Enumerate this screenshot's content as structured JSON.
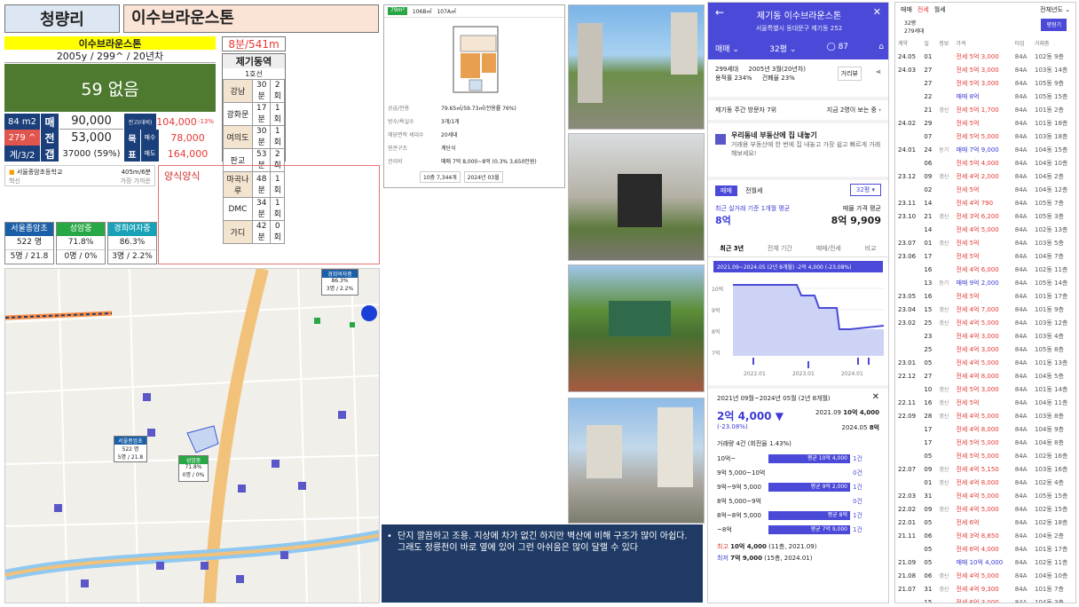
{
  "header": {
    "area": "청량리",
    "name": "이수브라운스톤"
  },
  "summary": {
    "name": "이수브라운스톤",
    "meta": "2005y / 299^ / 20년차",
    "walk": "8분/541m",
    "station": "제기동역",
    "line": "1호선",
    "big": "59 없음",
    "size": "84 m2",
    "size2": "279 ^",
    "plan": "계/3/2",
    "r1": {
      "k": "매",
      "v": "90,000",
      "k2": "전고(대비)",
      "v2": "104,000",
      "pct": "-13%"
    },
    "r2": {
      "k": "전",
      "v": "53,000",
      "k2": "목",
      "k3": "매수",
      "v2": "78,000"
    },
    "r3": {
      "k": "갭",
      "v": "37000 (59%)",
      "k2": "표",
      "k3": "매도",
      "v2": "164,000"
    }
  },
  "commute": [
    [
      "강남",
      "30분",
      "2회"
    ],
    [
      "광화문",
      "17분",
      "1회"
    ],
    [
      "여의도",
      "30분",
      "1회"
    ],
    [
      "판교",
      "53분",
      "2회"
    ],
    [
      "마곡나루",
      "48분",
      "1회"
    ],
    [
      "DMC",
      "34분",
      "1회"
    ],
    [
      "가디",
      "42분",
      "0회"
    ]
  ],
  "school": {
    "name": "서울종암초등학교",
    "dist": "405m/6분",
    "sub": "혁신",
    "sub2": "가장 가까운"
  },
  "note_box": "양식양식",
  "schools": [
    {
      "name": "서울종암초",
      "color": "#1a5fa8",
      "a": "522 명",
      "b": "5명 / 21.8"
    },
    {
      "name": "성암중",
      "color": "#28a745",
      "a": "71.8%",
      "b": "0명 / 0%"
    },
    {
      "name": "경희여자중",
      "color": "#17a2b8",
      "a": "86.3%",
      "b": "3명 / 2.2%"
    }
  ],
  "map": {
    "lbl1": {
      "t": "경희여자중",
      "a": "86.3%",
      "b": "3명 / 2.2%"
    },
    "lbl2": {
      "t": "서울종암초",
      "a": "522 명",
      "b": "5명 / 21.8"
    },
    "lbl3": {
      "t": "성암중",
      "a": "71.8%",
      "b": "0명 / 0%"
    }
  },
  "plan": {
    "tab": "79m²",
    "s1": "106B㎡",
    "s2": "107A㎡",
    "rows": [
      [
        "공급/전용",
        "79.65㎡/59.73㎡(전용률 76%)"
      ],
      [
        "방수/욕실수",
        "3개/1개"
      ],
      [
        "해당면적 세대수",
        "20세대"
      ],
      [
        "현관구조",
        "계단식"
      ],
      [
        "관리비",
        "매매 7억 8,000~8억 (0.3% 3,650만원)"
      ]
    ],
    "floor": "10층 7,344개",
    "month": "2024년 03월"
  },
  "comment": "단지 깔끔하고 조용. 지상에 차가 없긴 하지만 벽산에 비해 구조가 많이 아쉽다. 그래도 정릉천이 바로 옆에 있어 그런 아쉬움은 많이 달랠 수 있다",
  "app": {
    "title": "제기동 이수브라운스톤",
    "addr": "서울특별시 동대문구 제기동 252",
    "tab1": "매매",
    "tab2": "32평",
    "cnt": "87",
    "info1": "299세대",
    "info2": "2005년 3월(20년차)",
    "info3": "용적률 234%",
    "info4": "건폐율 23%",
    "btn": "거리뷰",
    "visit": "제기동 주간 방문자 7위",
    "visit2": "지금 2명이 보는 중",
    "promo": "우리동네 부동산에 집 내놓기",
    "promo2": "거래용 부동산에 한 번에 집 내놓고 가장 쉽고 빠르게 거래해보세요!",
    "seg1": "매매",
    "seg2": "전월세",
    "py": "32평",
    "recent": "최근 실거래 기준 1개월 평균",
    "recentv": "8억",
    "avg": "매물 가격 평균",
    "avgv": "8억 9,909",
    "ctabs": [
      "최근 3년",
      "전체 기간",
      "매매/전세",
      "비교"
    ],
    "range": "2021.09~2024.05 (2년 8개월) -2억 4,000 (-23.08%)",
    "yt": [
      "10억",
      "9억",
      "8억",
      "7억"
    ],
    "xt": [
      "2022.01",
      "2023.01",
      "2024.01"
    ],
    "p_head": "2021년 09월~2024년 05월 (2년 8개월)",
    "p_big": "2억 4,000",
    "p_pct": "(-23.08%)",
    "p_r1": "2021.09",
    "p_r1v": "10억 4,000",
    "p_r2": "2024.05",
    "p_r2v": "8억",
    "p_cnt": "거래량 4건 (회전율 1.43%)",
    "bars": [
      [
        "10억~",
        "평균 10억 4,000",
        "1건"
      ],
      [
        "9억 5,000~10억",
        "",
        "0건"
      ],
      [
        "9억~9억 5,000",
        "평균 9억 2,000",
        "1건"
      ],
      [
        "8억 5,000~9억",
        "",
        "0건"
      ],
      [
        "8억~8억 5,000",
        "평균 8억",
        "1건"
      ],
      [
        "~8억",
        "평균 7억 9,000",
        "1건"
      ]
    ],
    "max": "10억 4,000",
    "maxs": "(11층, 2021.09)",
    "min": "7억 9,000",
    "mins": "(15층, 2024.01)",
    "maxl": "최고",
    "minl": "최저"
  },
  "tx": {
    "tabs": [
      "매매",
      "전세",
      "월세"
    ],
    "filter": "전체년도",
    "sel": "32평",
    "sel2": "279세대",
    "btn": "평형기",
    "hdr": [
      "계약",
      "일",
      "정보",
      "가격",
      "타입",
      "거래층"
    ],
    "rows": [
      [
        "24.05",
        "01",
        "",
        "전세 5억 3,000",
        "84A",
        "102동 9층"
      ],
      [
        "24.03",
        "27",
        "",
        "전세 5억 3,000",
        "84A",
        "103동 14층"
      ],
      [
        "",
        "27",
        "",
        "전세 5억 3,000",
        "84A",
        "105동 9층"
      ],
      [
        "",
        "22",
        "",
        "매매 8억",
        "84A",
        "105동 15층"
      ],
      [
        "",
        "21",
        "갱신",
        "전세 5억 1,700",
        "84A",
        "101동 2층"
      ],
      [
        "24.02",
        "29",
        "",
        "전세 5억",
        "84A",
        "101동 18층"
      ],
      [
        "",
        "07",
        "",
        "전세 5억 5,000",
        "84A",
        "103동 18층"
      ],
      [
        "24.01",
        "24",
        "등기",
        "매매 7억 9,000",
        "84A",
        "104동 15층"
      ],
      [
        "",
        "06",
        "",
        "전세 5억 4,000",
        "84A",
        "104동 10층"
      ],
      [
        "23.12",
        "09",
        "갱신",
        "전세 4억 2,000",
        "84A",
        "104동 2층"
      ],
      [
        "",
        "02",
        "",
        "전세 5억",
        "84A",
        "104동 12층"
      ],
      [
        "23.11",
        "14",
        "",
        "전세 4억 790",
        "84A",
        "105동 7층"
      ],
      [
        "23.10",
        "21",
        "갱신",
        "전세 3억 6,200",
        "84A",
        "105동 3층"
      ],
      [
        "",
        "14",
        "",
        "전세 4억 5,000",
        "84A",
        "102동 13층"
      ],
      [
        "23.07",
        "01",
        "갱신",
        "전세 5억",
        "84A",
        "103동 5층"
      ],
      [
        "23.06",
        "17",
        "",
        "전세 5억",
        "84A",
        "104동 7층"
      ],
      [
        "",
        "16",
        "",
        "전세 4억 6,000",
        "84A",
        "102동 11층"
      ],
      [
        "",
        "13",
        "등기",
        "매매 9억 2,000",
        "84A",
        "105동 14층"
      ],
      [
        "23.05",
        "16",
        "",
        "전세 5억",
        "84A",
        "101동 17층"
      ],
      [
        "23.04",
        "15",
        "갱신",
        "전세 4억 7,000",
        "84A",
        "101동 9층"
      ],
      [
        "23.02",
        "25",
        "갱신",
        "전세 4억 5,000",
        "84A",
        "103동 12층"
      ],
      [
        "",
        "23",
        "",
        "전세 4억 3,000",
        "84A",
        "103동 4층"
      ],
      [
        "",
        "25",
        "",
        "전세 4억 3,000",
        "84A",
        "105동 8층"
      ],
      [
        "23.01",
        "05",
        "",
        "전세 4억 5,000",
        "84A",
        "101동 13층"
      ],
      [
        "22.12",
        "27",
        "",
        "전세 4억 8,000",
        "84A",
        "104동 5층"
      ],
      [
        "",
        "10",
        "갱신",
        "전세 5억 3,000",
        "84A",
        "101동 14층"
      ],
      [
        "22.11",
        "16",
        "갱신",
        "전세 5억",
        "84A",
        "104동 11층"
      ],
      [
        "22.09",
        "28",
        "갱신",
        "전세 4억 5,000",
        "84A",
        "103동 8층"
      ],
      [
        "",
        "17",
        "",
        "전세 4억 8,000",
        "84A",
        "104동 9층"
      ],
      [
        "",
        "17",
        "",
        "전세 5억 5,000",
        "84A",
        "104동 8층"
      ],
      [
        "",
        "05",
        "",
        "전세 5억 5,000",
        "84A",
        "102동 16층"
      ],
      [
        "22.07",
        "09",
        "갱신",
        "전세 4억 5,150",
        "84A",
        "103동 16층"
      ],
      [
        "",
        "01",
        "갱신",
        "전세 4억 8,000",
        "84A",
        "102동 4층"
      ],
      [
        "22.03",
        "31",
        "",
        "전세 4억 5,000",
        "84A",
        "105동 15층"
      ],
      [
        "22.02",
        "09",
        "갱신",
        "전세 4억 5,000",
        "84A",
        "102동 15층"
      ],
      [
        "22.01",
        "05",
        "",
        "전세 6억",
        "84A",
        "102동 18층"
      ],
      [
        "21.11",
        "06",
        "",
        "전세 3억 8,850",
        "84A",
        "104동 2층"
      ],
      [
        "",
        "05",
        "",
        "전세 6억 4,000",
        "84A",
        "101동 17층"
      ],
      [
        "21.09",
        "05",
        "",
        "매매 10억 4,000",
        "84A",
        "102동 11층"
      ],
      [
        "21.08",
        "06",
        "갱신",
        "전세 4억 5,000",
        "84A",
        "104동 10층"
      ],
      [
        "21.07",
        "31",
        "갱신",
        "전세 4억 9,300",
        "84A",
        "101동 7층"
      ],
      [
        "",
        "15",
        "",
        "전세 6억 3,000",
        "84A",
        "104동 3층"
      ]
    ]
  }
}
